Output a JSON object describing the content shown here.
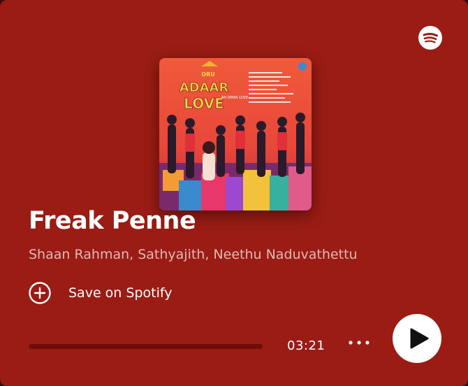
{
  "track": {
    "title": "Freak Penne",
    "artists": "Shaan Rahman, Sathyajith, Neethu Naduvathettu",
    "duration": "03:21",
    "progress_fraction": 0
  },
  "actions": {
    "save_label": "Save on Spotify"
  },
  "icons": {
    "logo": "spotify-icon",
    "save": "plus-circle-icon",
    "more": "more-horizontal-icon",
    "play": "play-icon"
  },
  "cover": {
    "title_text": "ORU ADAAR LOVE",
    "subtitle_text": "AN OMAR LOVE"
  },
  "colors": {
    "background": "#9a1c14",
    "artist_text": "#e4b8b2",
    "progress_track": "#6f0d07",
    "foreground": "#ffffff"
  }
}
